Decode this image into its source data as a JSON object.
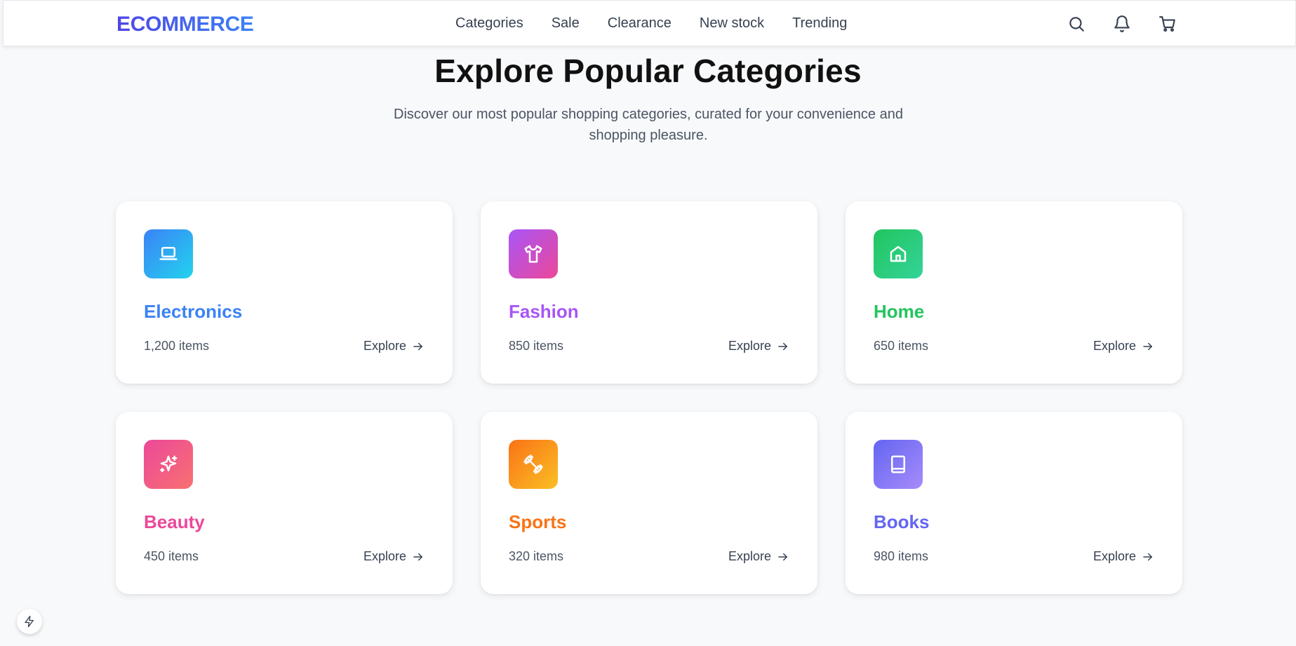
{
  "header": {
    "logo": "ECOMMERCE",
    "nav": [
      "Categories",
      "Sale",
      "Clearance",
      "New stock",
      "Trending"
    ],
    "icons": [
      "search-icon",
      "bell-icon",
      "cart-icon"
    ]
  },
  "hero": {
    "title": "Explore Popular Categories",
    "subtitle": "Discover our most popular shopping categories, curated for your convenience and shopping pleasure."
  },
  "categories": [
    {
      "name": "Electronics",
      "count": "1,200 items",
      "explore": "Explore",
      "icon": "laptop-icon",
      "color": "#3b82f6",
      "gradient": [
        "#3b82f6",
        "#22d3ee"
      ]
    },
    {
      "name": "Fashion",
      "count": "850 items",
      "explore": "Explore",
      "icon": "shirt-icon",
      "color": "#a855f7",
      "gradient": [
        "#a855f7",
        "#ec4899"
      ]
    },
    {
      "name": "Home",
      "count": "650 items",
      "explore": "Explore",
      "icon": "home-icon",
      "color": "#22c55e",
      "gradient": [
        "#22c55e",
        "#34d399"
      ]
    },
    {
      "name": "Beauty",
      "count": "450 items",
      "explore": "Explore",
      "icon": "sparkles-icon",
      "color": "#ec4899",
      "gradient": [
        "#ec4899",
        "#f87171"
      ]
    },
    {
      "name": "Sports",
      "count": "320 items",
      "explore": "Explore",
      "icon": "dumbbell-icon",
      "color": "#f97316",
      "gradient": [
        "#f97316",
        "#fbbf24"
      ]
    },
    {
      "name": "Books",
      "count": "980 items",
      "explore": "Explore",
      "icon": "book-icon",
      "color": "#6366f1",
      "gradient": [
        "#6366f1",
        "#a78bfa"
      ]
    }
  ],
  "floating": {
    "icon": "bolt-icon"
  }
}
